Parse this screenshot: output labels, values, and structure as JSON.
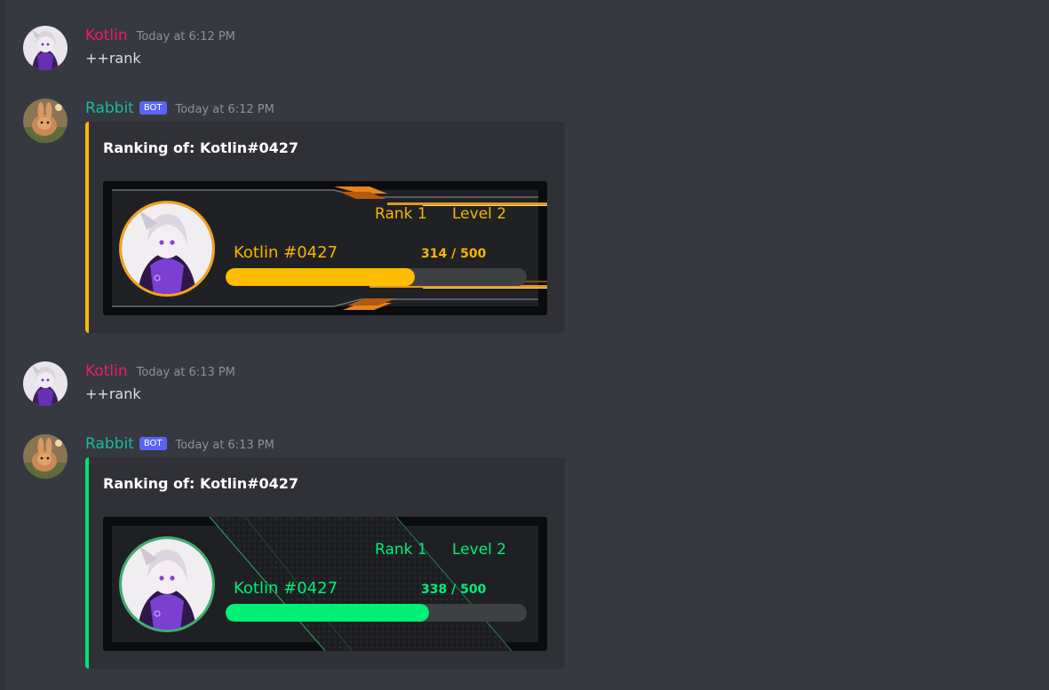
{
  "messages": [
    {
      "author": "Kotlin",
      "author_color": "#e91e63",
      "timestamp": "Today at 6:12 PM",
      "text": "++rank"
    },
    {
      "author": "Rabbit",
      "author_color": "#1abc9c",
      "bot_badge": "BOT",
      "timestamp": "Today at 6:12 PM",
      "embed": {
        "title": "Ranking of:  Kotlin#0427",
        "accent": "#ffb800",
        "card": {
          "rank_label": "Rank 1",
          "level_label": "Level  2",
          "username": "Kotlin",
          "discriminator": "#0427",
          "xp_text": "314  / 500",
          "xp_current": 314,
          "xp_max": 500,
          "theme": "orange",
          "accent": "#f7b500"
        }
      }
    },
    {
      "author": "Kotlin",
      "author_color": "#e91e63",
      "timestamp": "Today at 6:13 PM",
      "text": "++rank"
    },
    {
      "author": "Rabbit",
      "author_color": "#1abc9c",
      "bot_badge": "BOT",
      "timestamp": "Today at 6:13 PM",
      "embed": {
        "title": "Ranking of:  Kotlin#0427",
        "accent": "#00e676",
        "card": {
          "rank_label": "Rank 1",
          "level_label": "Level  2",
          "username": "Kotlin",
          "discriminator": "#0427",
          "xp_text": "338  / 500",
          "xp_current": 338,
          "xp_max": 500,
          "theme": "green",
          "accent": "#00f076"
        }
      }
    }
  ]
}
